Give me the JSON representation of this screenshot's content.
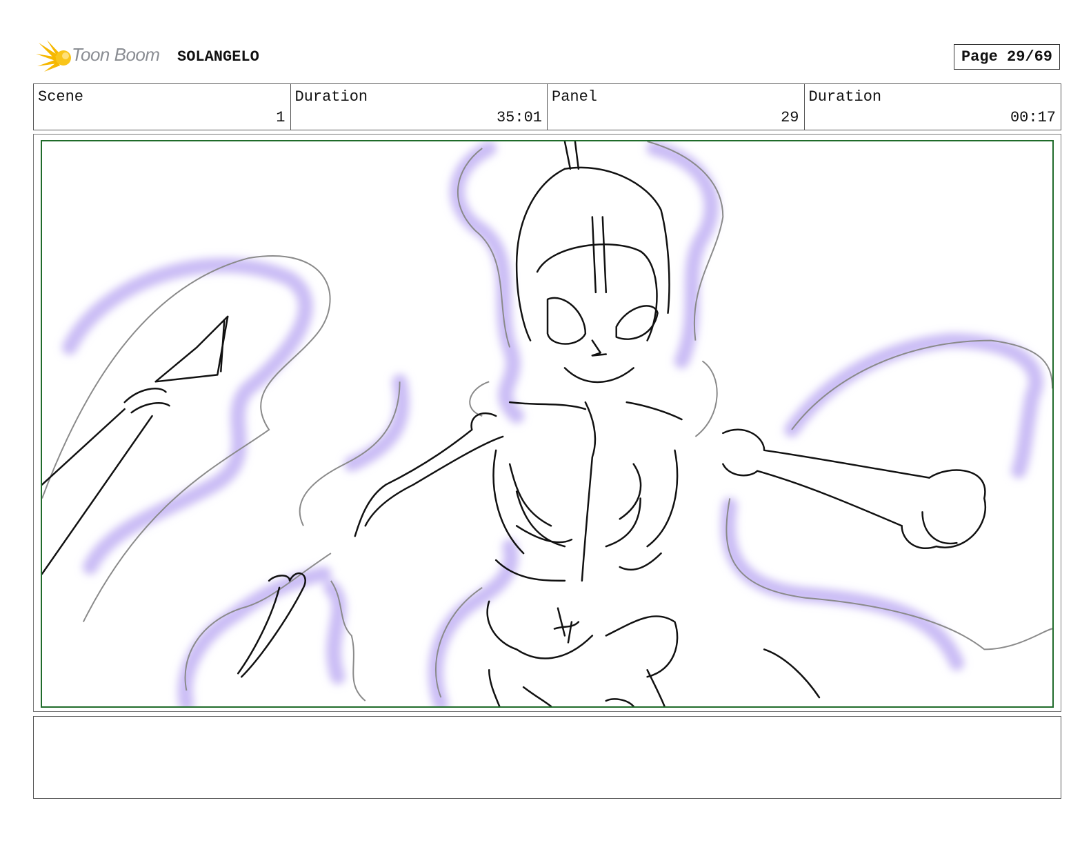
{
  "header": {
    "logo_text": "Toon Boom",
    "logo_icon": "starburst-logo-icon",
    "project_title": "SOLANGELO",
    "page_label": "Page 29/69"
  },
  "info": {
    "scene_label": "Scene",
    "scene_value": "1",
    "scene_duration_label": "Duration",
    "scene_duration_value": "35:01",
    "panel_label": "Panel",
    "panel_value": "29",
    "panel_duration_label": "Duration",
    "panel_duration_value": "00:17"
  },
  "panel": {
    "frame_color": "#1f6b2a",
    "glow_color": "#cbbdf5",
    "image_subject": "sketch-image"
  },
  "notes": {
    "text": ""
  }
}
